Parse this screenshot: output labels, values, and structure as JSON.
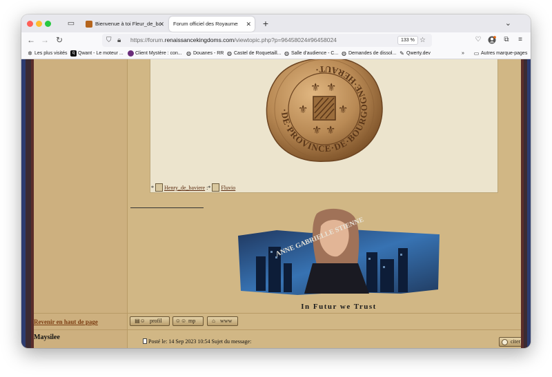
{
  "browser": {
    "tabs": [
      {
        "title": "Bienvenue à toi Fleur_de_baviere",
        "active": false
      },
      {
        "title": "Forum officiel des Royaumes Renaissance",
        "active": true
      }
    ],
    "new_tab": "+",
    "url_prefix": "https://forum.",
    "url_domain": "renaissancekingdoms.com",
    "url_path": "/viewtopic.php?p=96458024#96458024",
    "zoom": "133 %",
    "bookmarks": [
      {
        "label": "Les plus visités",
        "icon": "gear-icon"
      },
      {
        "label": "Qwant - Le moteur ...",
        "icon": "qwant-icon"
      },
      {
        "label": "Client Mystère : con...",
        "icon": "site-icon"
      },
      {
        "label": "Douanes - RR",
        "icon": "globe-icon"
      },
      {
        "label": "Castel de Roquetaill...",
        "icon": "globe-icon"
      },
      {
        "label": "Salle d'audience - C...",
        "icon": "globe-icon"
      },
      {
        "label": "Demandes de dissol...",
        "icon": "globe-icon"
      },
      {
        "label": "Qwerty.dev",
        "icon": "qwerty-icon"
      },
      {
        "label": "Autres marque-pages",
        "icon": "folder-icon"
      }
    ]
  },
  "post": {
    "seal_text": "·DE·PROVINCE·DE·BOURGOGNE·HERAUT·",
    "credit_prefix": "*",
    "credit_user1": "Henry_de_baviere",
    "credit_sep": " :*",
    "credit_user2": "Fluvio",
    "banner_name": "ANNE GABRIELLE STIENNE",
    "banner_motto": "In Futur we Trust",
    "back_to_top": "Revenir en haut de page",
    "btn_profil": "profil",
    "btn_mp": "mp",
    "btn_www": "www"
  },
  "next_post": {
    "author": "Maysilee",
    "posted": "Posté le: 14 Sep 2023 10:54 Sujet du message:",
    "quote_btn": "citer"
  },
  "colors": {
    "page_bg": "#d1b785",
    "quote_bg": "#ece4cd",
    "link": "#7a3b10",
    "seal": "#b98a55"
  }
}
